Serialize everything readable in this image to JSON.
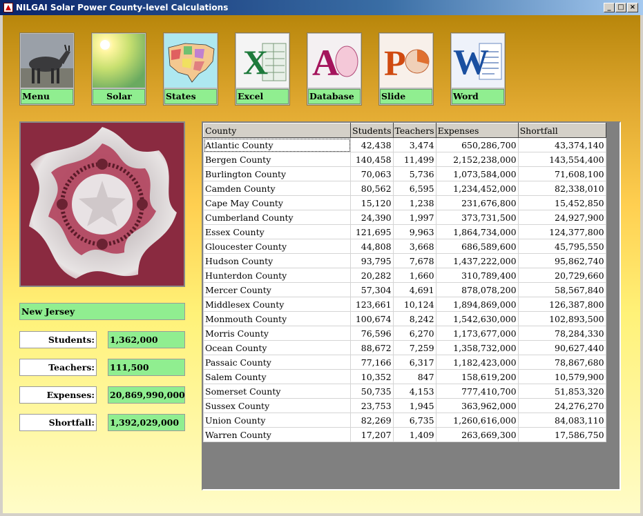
{
  "window": {
    "title": "NILGAI Solar Power County-level Calculations",
    "minimize": "_",
    "maximize": "□",
    "close": "×"
  },
  "toolbar": [
    {
      "id": "menu",
      "label": "Menu",
      "icon": "nilgai-antelope-icon"
    },
    {
      "id": "solar",
      "label": "Solar",
      "icon": "sun-icon"
    },
    {
      "id": "states",
      "label": "States",
      "icon": "us-map-icon"
    },
    {
      "id": "excel",
      "label": "Excel",
      "icon": "excel-icon",
      "glyph": "X",
      "color": "#1e7a3c"
    },
    {
      "id": "database",
      "label": "Database",
      "icon": "access-icon",
      "glyph": "A",
      "color": "#a4145c"
    },
    {
      "id": "slide",
      "label": "Slide",
      "icon": "powerpoint-icon",
      "glyph": "P",
      "color": "#d04a10"
    },
    {
      "id": "word",
      "label": "Word",
      "icon": "word-icon",
      "glyph": "W",
      "color": "#1a4fa0"
    }
  ],
  "summary": {
    "state": "New Jersey",
    "students_label": "Students:",
    "students_value": "1,362,000",
    "teachers_label": "Teachers:",
    "teachers_value": "111,500",
    "expenses_label": "Expenses:",
    "expenses_value": "20,869,990,000",
    "shortfall_label": "Shortfall:",
    "shortfall_value": "1,392,029,000"
  },
  "grid": {
    "columns": [
      "County",
      "Students",
      "Teachers",
      "Expenses",
      "Shortfall"
    ],
    "rows": [
      [
        "Atlantic County",
        "42,438",
        "3,474",
        "650,286,700",
        "43,374,140"
      ],
      [
        "Bergen County",
        "140,458",
        "11,499",
        "2,152,238,000",
        "143,554,400"
      ],
      [
        "Burlington County",
        "70,063",
        "5,736",
        "1,073,584,000",
        "71,608,100"
      ],
      [
        "Camden County",
        "80,562",
        "6,595",
        "1,234,452,000",
        "82,338,010"
      ],
      [
        "Cape May County",
        "15,120",
        "1,238",
        "231,676,800",
        "15,452,850"
      ],
      [
        "Cumberland County",
        "24,390",
        "1,997",
        "373,731,500",
        "24,927,900"
      ],
      [
        "Essex County",
        "121,695",
        "9,963",
        "1,864,734,000",
        "124,377,800"
      ],
      [
        "Gloucester County",
        "44,808",
        "3,668",
        "686,589,600",
        "45,795,550"
      ],
      [
        "Hudson County",
        "93,795",
        "7,678",
        "1,437,222,000",
        "95,862,740"
      ],
      [
        "Hunterdon County",
        "20,282",
        "1,660",
        "310,789,400",
        "20,729,660"
      ],
      [
        "Mercer County",
        "57,304",
        "4,691",
        "878,078,200",
        "58,567,840"
      ],
      [
        "Middlesex County",
        "123,661",
        "10,124",
        "1,894,869,000",
        "126,387,800"
      ],
      [
        "Monmouth County",
        "100,674",
        "8,242",
        "1,542,630,000",
        "102,893,500"
      ],
      [
        "Morris County",
        "76,596",
        "6,270",
        "1,173,677,000",
        "78,284,330"
      ],
      [
        "Ocean County",
        "88,672",
        "7,259",
        "1,358,732,000",
        "90,627,440"
      ],
      [
        "Passaic County",
        "77,166",
        "6,317",
        "1,182,423,000",
        "78,867,680"
      ],
      [
        "Salem County",
        "10,352",
        "847",
        "158,619,200",
        "10,579,900"
      ],
      [
        "Somerset County",
        "50,735",
        "4,153",
        "777,410,700",
        "51,853,320"
      ],
      [
        "Sussex County",
        "23,753",
        "1,945",
        "363,962,000",
        "24,276,270"
      ],
      [
        "Union County",
        "82,269",
        "6,735",
        "1,260,616,000",
        "84,083,110"
      ],
      [
        "Warren County",
        "17,207",
        "1,409",
        "263,669,300",
        "17,586,750"
      ]
    ]
  },
  "colors": {
    "accent_green": "#90ee90",
    "grid_background": "#808080"
  }
}
